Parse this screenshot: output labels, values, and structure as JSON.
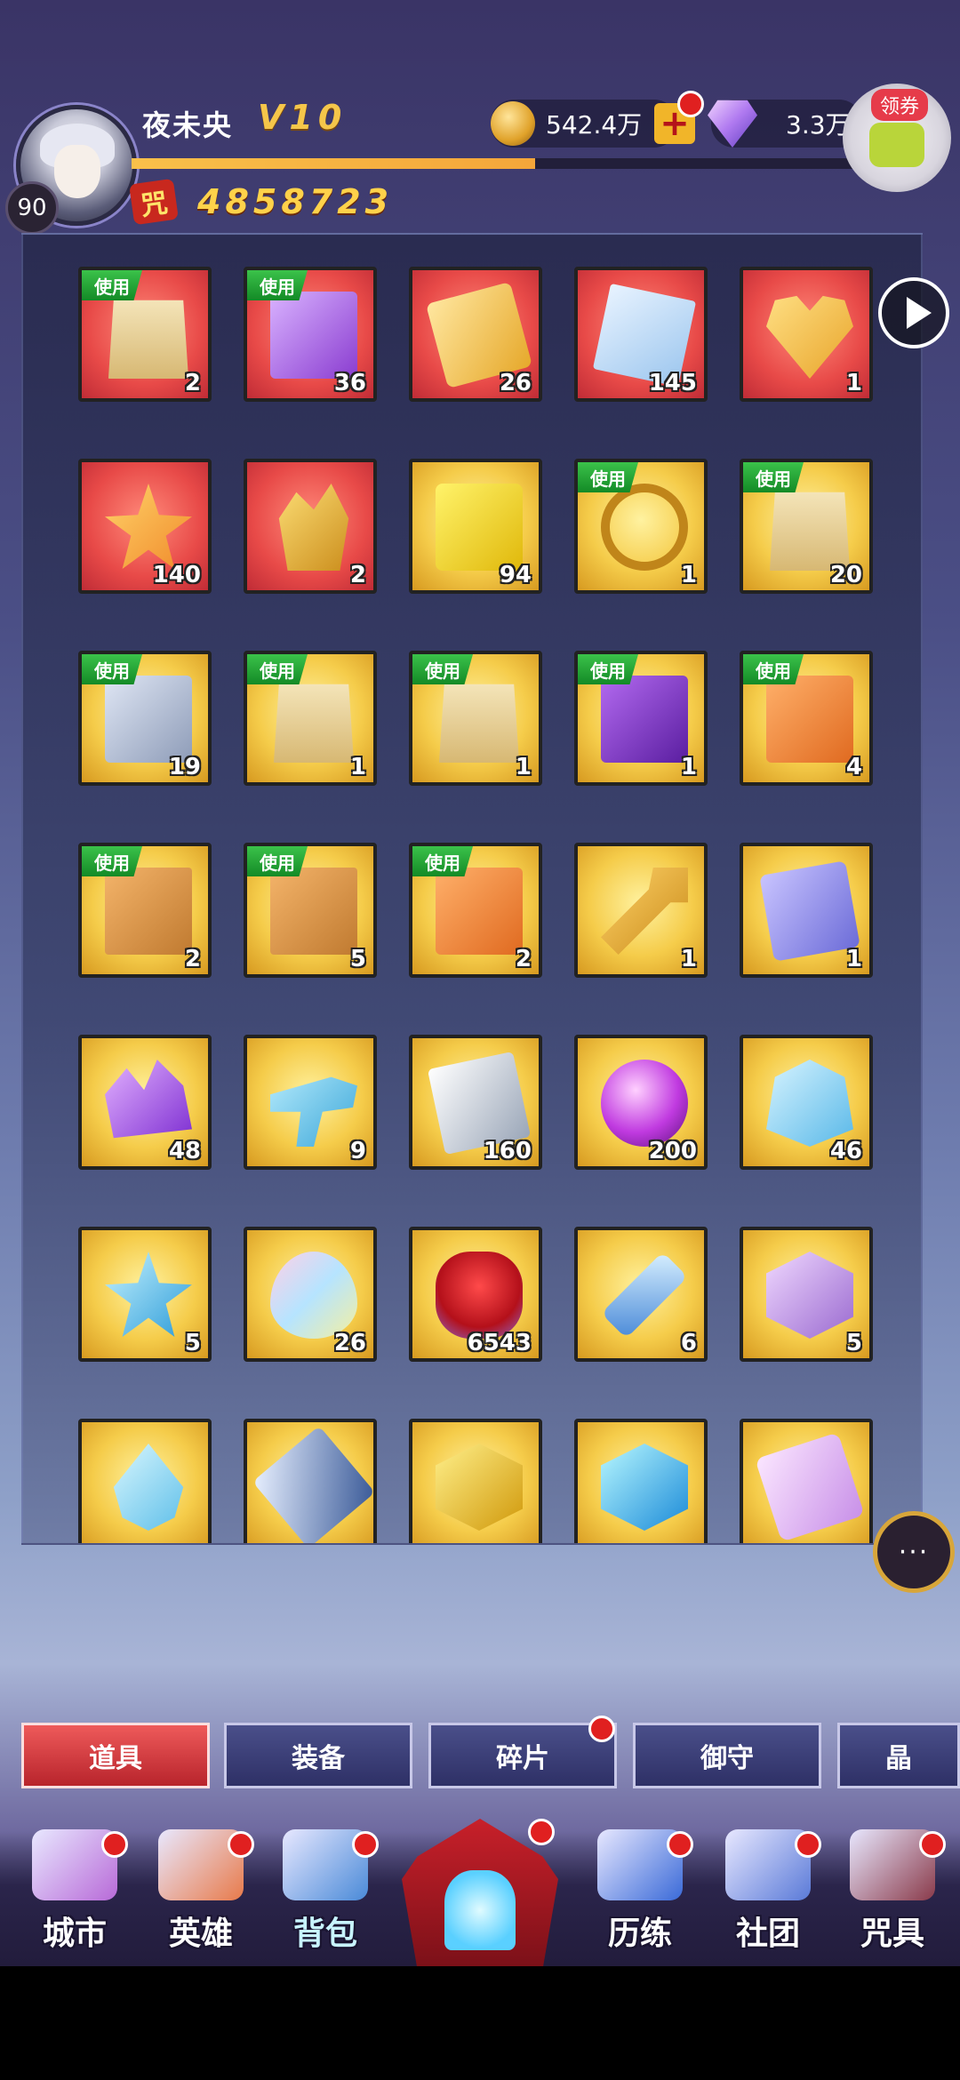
{
  "player": {
    "name": "夜未央",
    "vip": "V10",
    "level": "90",
    "power_icon": "咒",
    "power": "4858723",
    "xp_fraction": 0.54
  },
  "currency": {
    "coins": "542.4万",
    "gems": "3.3万",
    "voucher_label": "领券"
  },
  "items": [
    {
      "count": "2",
      "use": true,
      "bg": "red",
      "art": "a-bag",
      "icon": "gift-bag-icon"
    },
    {
      "count": "36",
      "use": true,
      "bg": "red",
      "art": "a-card",
      "icon": "usr-card-icon"
    },
    {
      "count": "26",
      "use": false,
      "bg": "red",
      "art": "a-ticket",
      "icon": "gold-ticket-icon"
    },
    {
      "count": "145",
      "use": false,
      "bg": "red",
      "art": "a-paper",
      "icon": "blueprint-icon"
    },
    {
      "count": "1",
      "use": false,
      "bg": "red",
      "art": "a-heart",
      "icon": "heart-box-icon"
    },
    {
      "count": "140",
      "use": false,
      "bg": "red",
      "art": "a-star",
      "icon": "star-candy-icon"
    },
    {
      "count": "2",
      "use": false,
      "bg": "red",
      "art": "a-crystal",
      "icon": "gold-crystal-icon"
    },
    {
      "count": "94",
      "use": false,
      "bg": "gold",
      "art": "a-goldbar",
      "icon": "gold-bar-icon"
    },
    {
      "count": "1",
      "use": true,
      "bg": "gold",
      "art": "a-ring",
      "icon": "ring-icon"
    },
    {
      "count": "20",
      "use": true,
      "bg": "gold",
      "art": "a-bag",
      "icon": "supply-bag-icon"
    },
    {
      "count": "19",
      "use": true,
      "bg": "gold",
      "art": "a-gift",
      "icon": "silver-gift-icon"
    },
    {
      "count": "1",
      "use": true,
      "bg": "gold",
      "art": "a-bag",
      "icon": "crystal-bag-icon"
    },
    {
      "count": "1",
      "use": true,
      "bg": "gold",
      "art": "a-bag",
      "icon": "orb-bag-icon"
    },
    {
      "count": "1",
      "use": true,
      "bg": "gold",
      "art": "a-purplebox",
      "icon": "purple-box-icon"
    },
    {
      "count": "4",
      "use": true,
      "bg": "gold",
      "art": "a-orangebag",
      "icon": "orange-bag-icon"
    },
    {
      "count": "2",
      "use": true,
      "bg": "gold",
      "art": "a-mystery",
      "icon": "mystery-box-icon"
    },
    {
      "count": "5",
      "use": true,
      "bg": "gold",
      "art": "a-mystery",
      "icon": "mystery-box-2star-icon"
    },
    {
      "count": "2",
      "use": true,
      "bg": "gold",
      "art": "a-orangebag",
      "icon": "orange-pack-icon"
    },
    {
      "count": "1",
      "use": false,
      "bg": "gold",
      "art": "a-key",
      "icon": "gold-key-icon"
    },
    {
      "count": "1",
      "use": false,
      "bg": "gold",
      "art": "a-ticketblue",
      "icon": "ticket-icon"
    },
    {
      "count": "48",
      "use": false,
      "bg": "gold",
      "art": "a-purplecrystal",
      "icon": "purple-crystal-icon"
    },
    {
      "count": "9",
      "use": false,
      "bg": "gold",
      "art": "a-gun",
      "icon": "water-gun-icon"
    },
    {
      "count": "160",
      "use": false,
      "bg": "gold",
      "art": "a-silvercard",
      "icon": "silver-card-icon"
    },
    {
      "count": "200",
      "use": false,
      "bg": "gold",
      "art": "a-orb",
      "icon": "purple-orb-icon"
    },
    {
      "count": "46",
      "use": false,
      "bg": "gold",
      "art": "a-bluebag",
      "icon": "blue-bag-icon"
    },
    {
      "count": "5",
      "use": false,
      "bg": "gold",
      "art": "a-bluestar",
      "icon": "blue-star-icon"
    },
    {
      "count": "26",
      "use": false,
      "bg": "gold",
      "art": "a-rainbow",
      "icon": "rainbow-stone-icon"
    },
    {
      "count": "6543",
      "use": false,
      "bg": "gold",
      "art": "a-roses",
      "icon": "rose-bouquet-icon"
    },
    {
      "count": "6",
      "use": false,
      "bg": "gold",
      "art": "a-syringe",
      "icon": "syringe-icon"
    },
    {
      "count": "5",
      "use": false,
      "bg": "gold",
      "art": "a-purplecube",
      "icon": "purple-cube-icon"
    },
    {
      "count": "",
      "use": false,
      "bg": "gold",
      "art": "a-drop",
      "icon": "ice-drop-icon"
    },
    {
      "count": "",
      "use": false,
      "bg": "gold",
      "art": "a-sword",
      "icon": "blue-blade-icon"
    },
    {
      "count": "",
      "use": false,
      "bg": "gold",
      "art": "a-goldcube",
      "icon": "gold-cube-icon"
    },
    {
      "count": "",
      "use": false,
      "bg": "gold",
      "art": "a-bluecube",
      "icon": "blue-cube-icon"
    },
    {
      "count": "",
      "use": false,
      "bg": "gold",
      "art": "a-scroll",
      "icon": "spiral-scroll-icon"
    }
  ],
  "use_label": "使用",
  "tabs": [
    {
      "label": "道具",
      "dot": false
    },
    {
      "label": "装备",
      "dot": false
    },
    {
      "label": "碎片",
      "dot": true
    },
    {
      "label": "御守",
      "dot": false
    },
    {
      "label": "晶",
      "dot": false
    }
  ],
  "nav": [
    {
      "label": "城市",
      "icon": "city-icon"
    },
    {
      "label": "英雄",
      "icon": "hero-icon"
    },
    {
      "label": "背包",
      "icon": "backpack-icon"
    },
    {
      "label": "历练",
      "icon": "training-icon"
    },
    {
      "label": "社团",
      "icon": "club-icon"
    },
    {
      "label": "咒具",
      "icon": "cursed-tool-icon"
    }
  ],
  "chat_label": "···"
}
